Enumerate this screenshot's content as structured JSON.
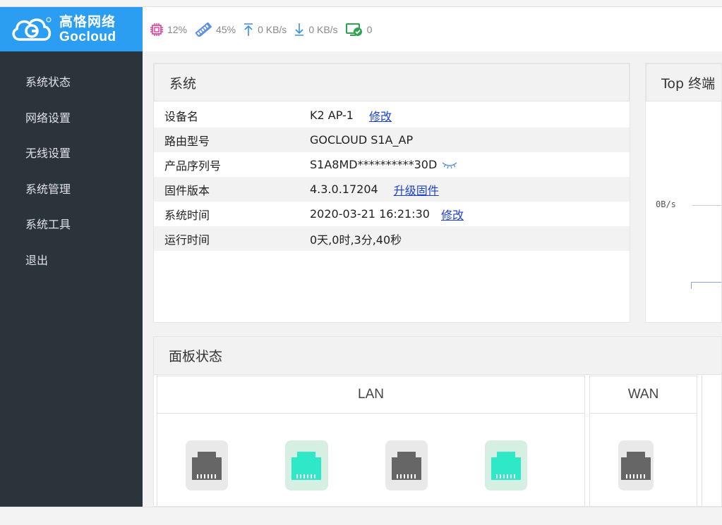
{
  "brand": {
    "cn": "高恪网络",
    "en": "Gocloud",
    "color": "#2c9ef2"
  },
  "status": {
    "cpu": "12%",
    "memory": "45%",
    "upload": "0 KB/s",
    "download": "0 KB/s",
    "clients": "0"
  },
  "sidebar": {
    "items": [
      {
        "label": "系统状态"
      },
      {
        "label": "网络设置"
      },
      {
        "label": "无线设置"
      },
      {
        "label": "系统管理"
      },
      {
        "label": "系统工具"
      },
      {
        "label": "退出"
      }
    ]
  },
  "system": {
    "title": "系统",
    "rows": [
      {
        "key": "设备名",
        "value": "K2 AP-1",
        "action": "修改"
      },
      {
        "key": "路由型号",
        "value": "GOCLOUD S1A_AP"
      },
      {
        "key": "产品序列号",
        "value": "S1A8MD**********30D"
      },
      {
        "key": "固件版本",
        "value": "4.3.0.17204",
        "action": "升级固件"
      },
      {
        "key": "系统时间",
        "value": "2020-03-21 16:21:30",
        "action": "修改"
      },
      {
        "key": "运行时间",
        "value": "0天,0时,3分,40秒"
      }
    ]
  },
  "top_clients": {
    "title": "Top 终端",
    "axis_label": "0B/s"
  },
  "board": {
    "title": "面板状态",
    "lan_label": "LAN",
    "wan_label": "WAN",
    "lan_ports": [
      {
        "state": "off"
      },
      {
        "state": "on"
      },
      {
        "state": "off"
      },
      {
        "state": "on"
      }
    ],
    "wan_ports": [
      {
        "state": "off"
      }
    ],
    "colors": {
      "port_on": "#2ee8c8",
      "port_off": "#666666",
      "link": "#1a3fd6"
    }
  }
}
